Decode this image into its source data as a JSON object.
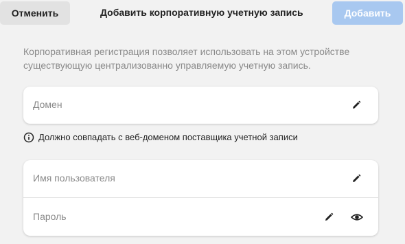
{
  "header": {
    "cancel_label": "Отменить",
    "title": "Добавить корпоративную учетную запись",
    "add_label": "Добавить"
  },
  "description": "Корпоративная регистрация позволяет использовать на этом устройстве существующую централизованно управляемую учетную запись.",
  "domain_field": {
    "label": "Домен",
    "edit_icon": "pencil-icon"
  },
  "hint": {
    "icon": "info-icon",
    "text": "Должно совпадать с веб-доменом поставщика учетной записи"
  },
  "credentials": {
    "username_label": "Имя пользователя",
    "password_label": "Пароль",
    "edit_icon": "pencil-icon",
    "reveal_icon": "eye-icon"
  },
  "colors": {
    "background": "#f2f2f2",
    "card": "#ffffff",
    "primary_disabled": "#a8c8f0",
    "cancel_bg": "#e2e2e2",
    "muted_text": "#8a8a8a"
  }
}
